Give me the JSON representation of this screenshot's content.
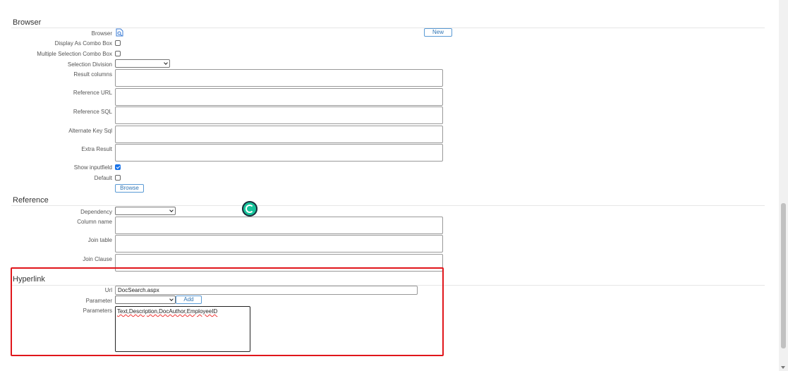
{
  "browser_section": {
    "title": "Browser",
    "browser_label": "Browser",
    "new_button": "New",
    "display_as_combo_label": "Display As Combo Box",
    "multiple_selection_label": "Multiple Selection Combo Box",
    "selection_division_label": "Selection Division",
    "result_columns_label": "Result columns",
    "reference_url_label": "Reference URL",
    "reference_sql_label": "Reference SQL",
    "alternate_key_label": "Alternate Key Sql",
    "extra_result_label": "Extra Result",
    "show_inputfield_label": "Show inputfield",
    "show_inputfield_checked": true,
    "default_label": "Default",
    "browse_button": "Browse"
  },
  "reference_section": {
    "title": "Reference",
    "dependency_label": "Dependency",
    "column_name_label": "Column name",
    "join_table_label": "Join table",
    "join_clause_label": "Join Clause"
  },
  "hyperlink_section": {
    "title": "Hyperlink",
    "url_label": "Url",
    "url_value": "DocSearch.aspx",
    "parameter_label": "Parameter",
    "add_button": "Add",
    "parameters_label": "Parameters",
    "parameters_value": "Text,Description,DocAuthor,EmployeeID"
  },
  "colors": {
    "highlight": "#e0161b",
    "accent": "#1a73e8",
    "button_border": "#5b9bd5"
  }
}
